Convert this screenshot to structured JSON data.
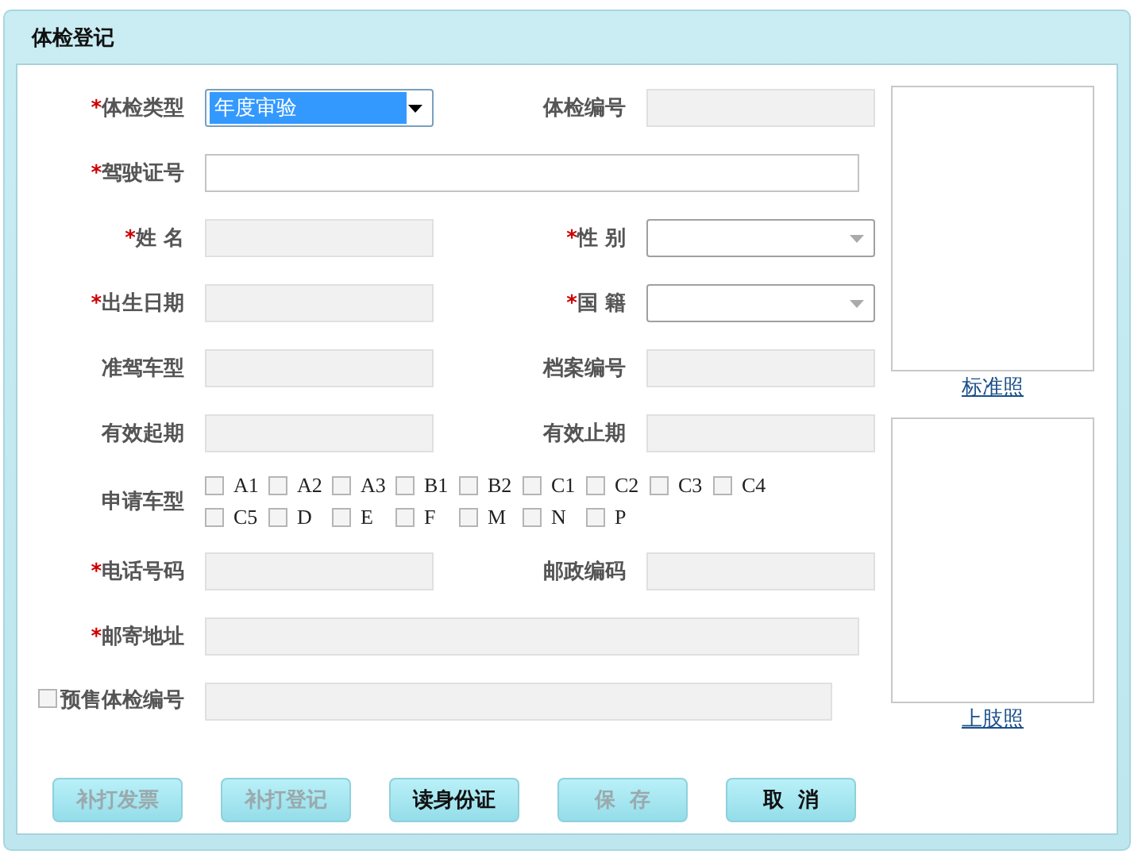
{
  "panel": {
    "title": "体检登记"
  },
  "rows": [
    {
      "kind": "pair",
      "fields": [
        {
          "label": "体检类型",
          "mark": "*",
          "kind": "select",
          "value": "年度审验",
          "highlighted": true,
          "disabled": false
        },
        {
          "label": "体检编号",
          "kind": "text",
          "disabled": true
        }
      ]
    },
    {
      "kind": "wide",
      "fields": [
        {
          "label": "驾驶证号",
          "mark": "*",
          "kind": "text",
          "disabled": false
        }
      ]
    },
    {
      "kind": "pair",
      "fields": [
        {
          "label": "姓 名",
          "mark": "*",
          "kind": "text",
          "disabled": true
        },
        {
          "label": "性 别",
          "mark": "*",
          "kind": "select",
          "highlighted": false,
          "disabled": false
        }
      ]
    },
    {
      "kind": "pair",
      "fields": [
        {
          "label": "出生日期",
          "mark": "*",
          "kind": "text",
          "disabled": true
        },
        {
          "label": "国 籍",
          "mark": "*",
          "kind": "select",
          "highlighted": false,
          "disabled": false
        }
      ]
    },
    {
      "kind": "pair",
      "fields": [
        {
          "label": "准驾车型",
          "kind": "text",
          "disabled": true
        },
        {
          "label": "档案编号",
          "kind": "text",
          "disabled": true
        }
      ]
    },
    {
      "kind": "pair",
      "fields": [
        {
          "label": "有效起期",
          "kind": "text",
          "disabled": true
        },
        {
          "label": "有效止期",
          "kind": "text",
          "disabled": true
        }
      ]
    },
    {
      "kind": "checks",
      "label": "申请车型",
      "options": [
        {
          "label": "A1",
          "checked": false
        },
        {
          "label": "A2",
          "checked": false
        },
        {
          "label": "A3",
          "checked": false
        },
        {
          "label": "B1",
          "checked": false
        },
        {
          "label": "B2",
          "checked": false
        },
        {
          "label": "C1",
          "checked": false
        },
        {
          "label": "C2",
          "checked": false
        },
        {
          "label": "C3",
          "checked": false
        },
        {
          "label": "C4",
          "checked": false
        },
        {
          "label": "C5",
          "checked": false
        },
        {
          "label": "D",
          "checked": false
        },
        {
          "label": "E",
          "checked": false
        },
        {
          "label": "F",
          "checked": false
        },
        {
          "label": "M",
          "checked": false
        },
        {
          "label": "N",
          "checked": false
        },
        {
          "label": "P",
          "checked": false
        }
      ]
    },
    {
      "kind": "pair",
      "fields": [
        {
          "label": "电话号码",
          "mark": "*",
          "kind": "text",
          "disabled": true
        },
        {
          "label": "邮政编码",
          "kind": "text",
          "disabled": true
        }
      ]
    },
    {
      "kind": "wide",
      "fields": [
        {
          "label": "邮寄地址",
          "mark": "*",
          "kind": "text",
          "disabled": true
        }
      ]
    },
    {
      "kind": "presale",
      "label": "预售体检编号",
      "checked": false,
      "disabled": true
    }
  ],
  "photos": [
    {
      "link": "标准照"
    },
    {
      "link": "上肢照"
    }
  ],
  "buttons": [
    {
      "label": "补打发票",
      "disabled": true
    },
    {
      "label": "补打登记",
      "disabled": true
    },
    {
      "label": "读身份证",
      "disabled": false
    },
    {
      "label": "保  存",
      "disabled": true
    },
    {
      "label": "取  消",
      "disabled": false
    }
  ]
}
